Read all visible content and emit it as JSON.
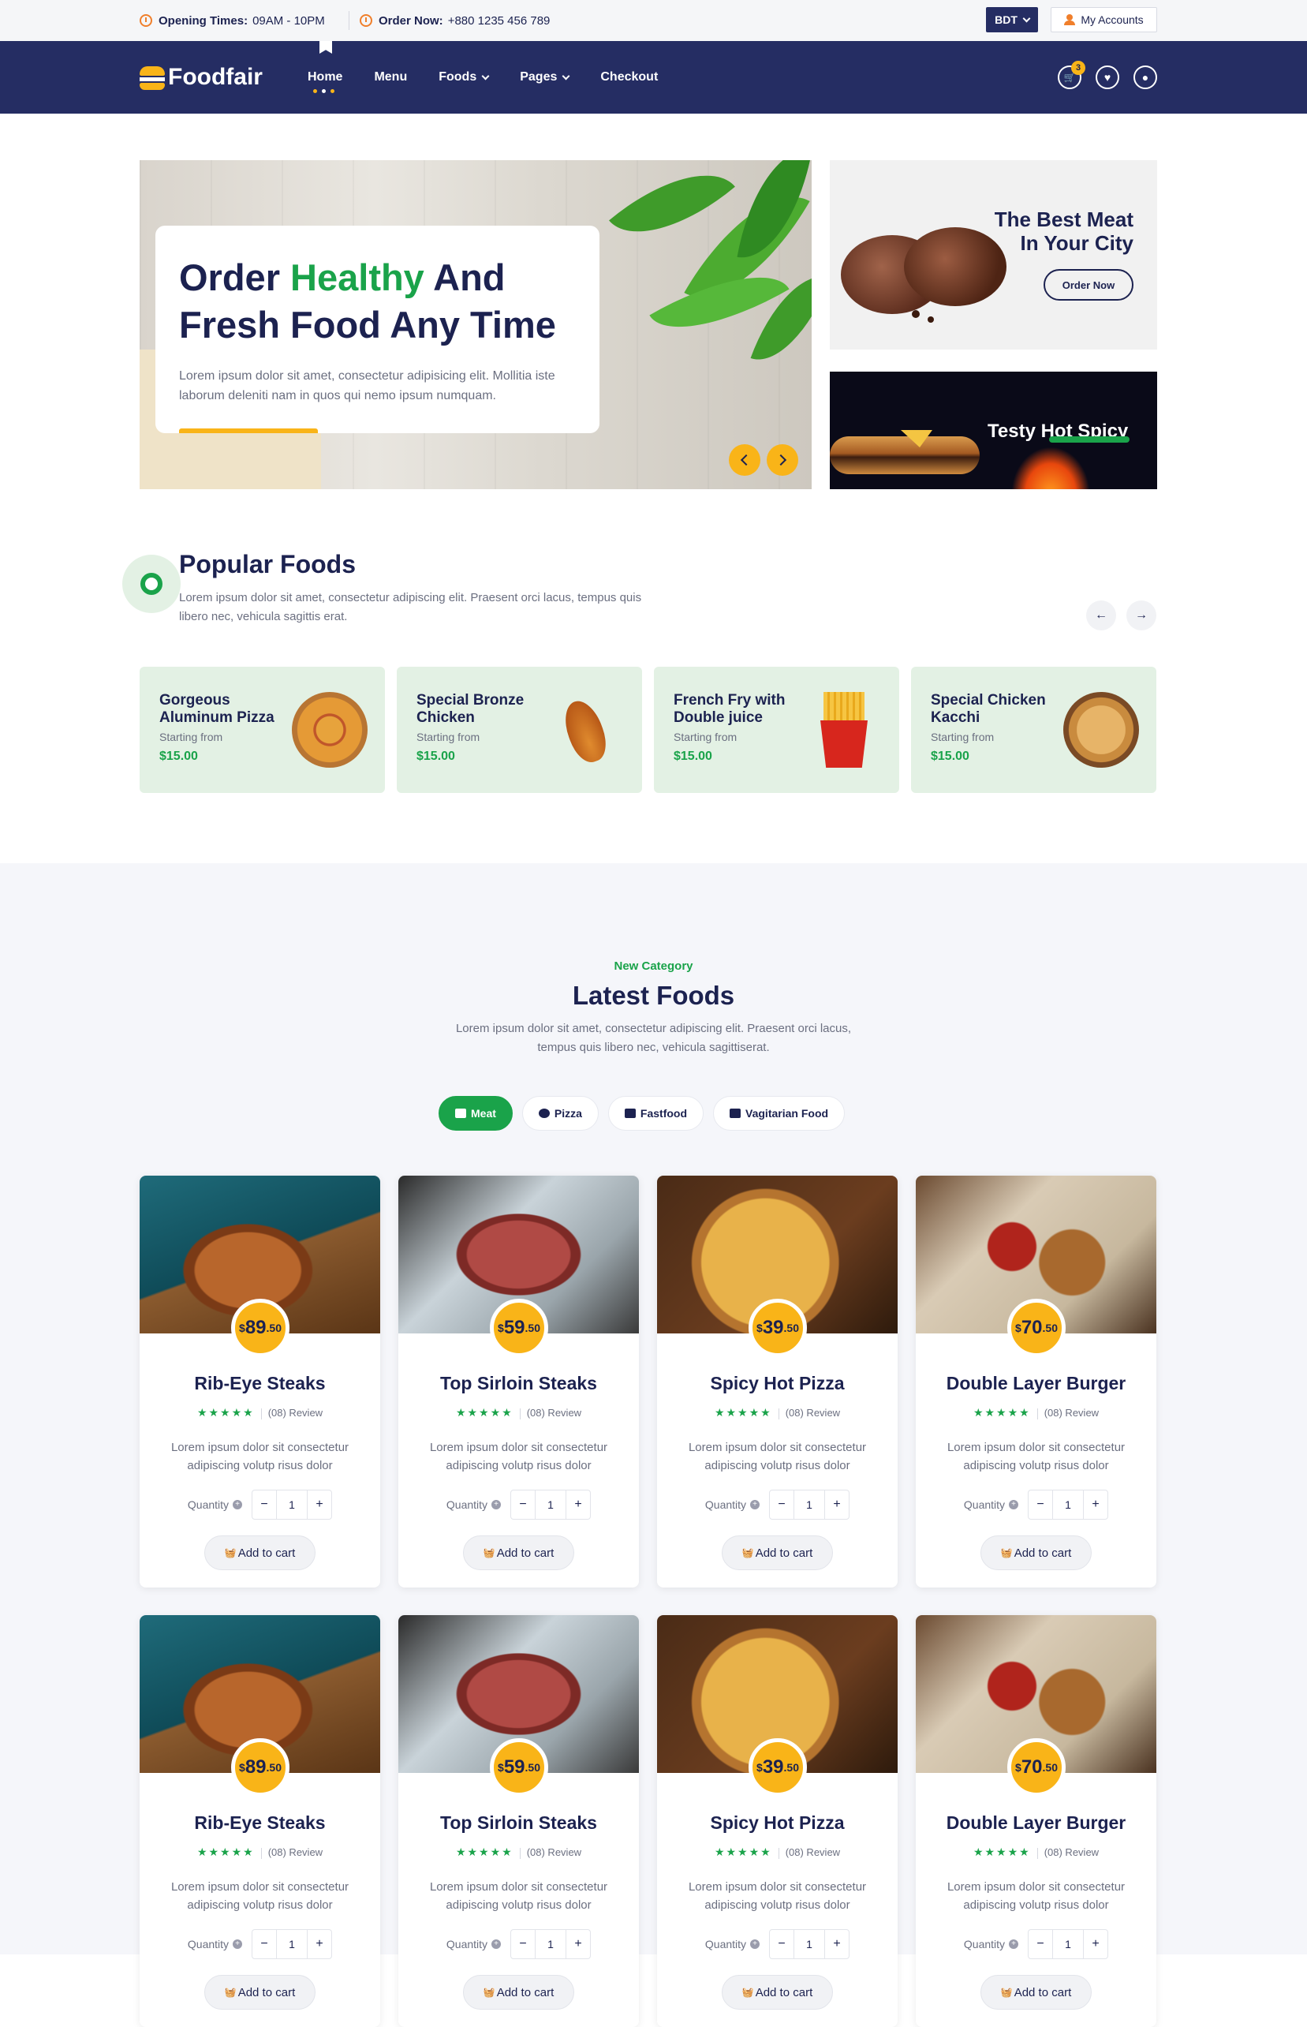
{
  "topbar": {
    "opening_label": "Opening Times:",
    "opening_value": "09AM - 10PM",
    "order_label": "Order Now:",
    "order_value": "+880 1235 456 789",
    "currency": "BDT",
    "account": "My Accounts"
  },
  "nav": {
    "logo": "Foodfair",
    "items": [
      {
        "label": "Home"
      },
      {
        "label": "Menu"
      },
      {
        "label": "Foods"
      },
      {
        "label": "Pages"
      },
      {
        "label": "Checkout"
      }
    ],
    "cart_count": "3"
  },
  "hero": {
    "title_1": "Order ",
    "title_highlight": "Healthy",
    "title_2": " And",
    "title_3": "Fresh Food Any Time",
    "text": "Lorem ipsum dolor sit amet, consectetur adipisicing elit. Mollitia iste laborum deleniti nam in quos qui nemo ipsum numquam."
  },
  "promo1": {
    "title_1": "The Best Meat",
    "title_2": "In Your City",
    "button": "Order Now"
  },
  "promo2": {
    "title": "Testy Hot Spicy"
  },
  "popular": {
    "title": "Popular Foods",
    "subtitle": "Lorem ipsum dolor sit amet, consectetur adipiscing elit. Praesent orci lacus, tempus quis libero nec, vehicula sagittis erat.",
    "items": [
      {
        "name": "Gorgeous Aluminum Pizza",
        "from": "Starting from",
        "price": "$15.00"
      },
      {
        "name": "Special Bronze Chicken",
        "from": "Starting from",
        "price": "$15.00"
      },
      {
        "name": "French Fry with Double juice",
        "from": "Starting from",
        "price": "$15.00"
      },
      {
        "name": "Special Chicken Kacchi",
        "from": "Starting from",
        "price": "$15.00"
      }
    ]
  },
  "latest": {
    "eyebrow": "New Category",
    "title": "Latest Foods",
    "subtitle": "Lorem ipsum dolor sit amet, consectetur adipiscing elit. Praesent orci lacus, tempus quis libero nec, vehicula sagittiserat.",
    "tabs": [
      "Meat",
      "Pizza",
      "Fastfood",
      "Vagitarian Food"
    ],
    "quantity_label": "Quantity",
    "cart_label": "Add to cart",
    "review": "(08) Review",
    "stars": "★★★★★",
    "desc": "Lorem ipsum dolor sit consectetur adipiscing volutp risus dolor",
    "products": [
      {
        "name": "Rib-Eye Steaks",
        "price_whole": "89",
        "price_cents": ".50",
        "qty": "1"
      },
      {
        "name": "Top Sirloin Steaks",
        "price_whole": "59",
        "price_cents": ".50",
        "qty": "1"
      },
      {
        "name": "Spicy Hot Pizza",
        "price_whole": "39",
        "price_cents": ".50",
        "qty": "1"
      },
      {
        "name": "Double Layer Burger",
        "price_whole": "70",
        "price_cents": ".50",
        "qty": "1"
      }
    ],
    "currency_symbol": "$"
  }
}
